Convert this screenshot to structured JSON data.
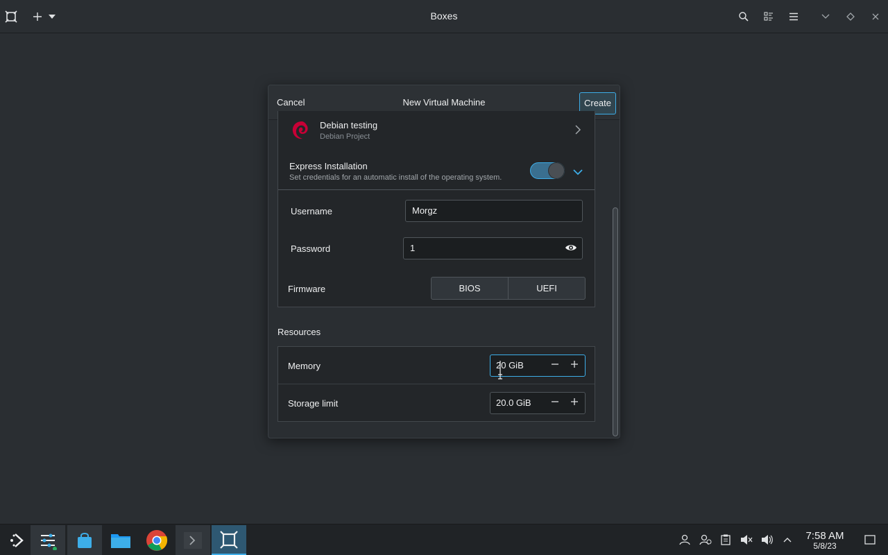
{
  "window": {
    "title": "Boxes",
    "icons": [
      "boxes-app-icon",
      "add-icon",
      "dropdown-icon",
      "search-icon",
      "view-toggle-icon",
      "menu-icon",
      "minimize-icon",
      "maximize-icon",
      "close-icon"
    ]
  },
  "dialog": {
    "title": "New Virtual Machine",
    "cancel_label": "Cancel",
    "create_label": "Create",
    "os": {
      "name": "Debian testing",
      "vendor": "Debian Project",
      "icon": "debian-logo-icon"
    },
    "express": {
      "title": "Express Installation",
      "subtitle": "Set credentials for an automatic install of the operating system.",
      "enabled": true
    },
    "username": {
      "label": "Username",
      "value": "Morgz"
    },
    "password": {
      "label": "Password",
      "value": "1"
    },
    "firmware": {
      "label": "Firmware",
      "options": [
        "BIOS",
        "UEFI"
      ]
    },
    "resources": {
      "heading": "Resources",
      "memory": {
        "label": "Memory",
        "value": "20 GiB"
      },
      "storage": {
        "label": "Storage limit",
        "value": "20.0 GiB"
      }
    }
  },
  "taskbar": {
    "apps": [
      "app-launcher-icon",
      "system-settings-icon",
      "discover-store-icon",
      "file-manager-icon",
      "chrome-icon",
      "terminal-icon",
      "boxes-icon"
    ],
    "tray": [
      "user-icon",
      "user-switch-icon",
      "clipboard-icon",
      "mute-icon",
      "volume-icon",
      "expand-tray-icon"
    ],
    "time": "7:58 AM",
    "date": "5/8/23"
  },
  "colors": {
    "accent": "#3daee9",
    "background": "#2a2e32",
    "card": "#232629"
  }
}
